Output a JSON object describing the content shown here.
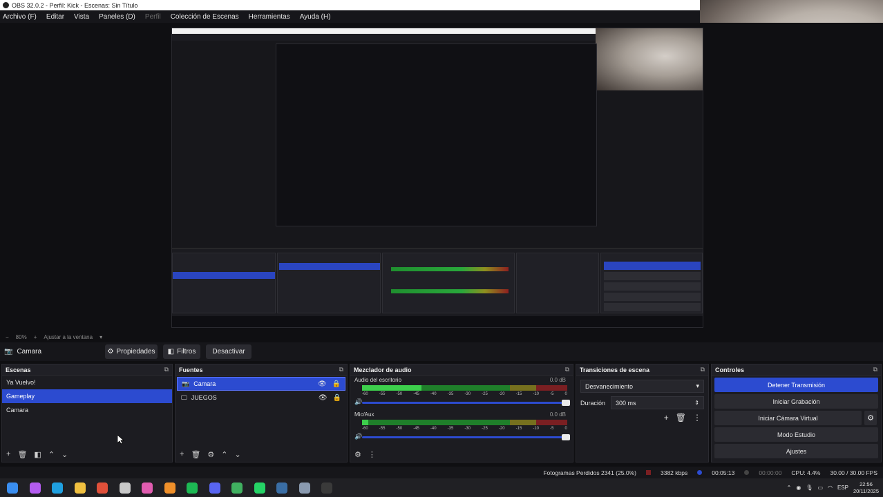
{
  "window": {
    "title": "OBS 32.0.2 - Perfil: Kick - Escenas: Sin Título"
  },
  "menu": [
    {
      "label": "Archivo (F)",
      "enabled": true
    },
    {
      "label": "Editar",
      "enabled": true
    },
    {
      "label": "Vista",
      "enabled": true
    },
    {
      "label": "Paneles (D)",
      "enabled": true
    },
    {
      "label": "Perfil",
      "enabled": false
    },
    {
      "label": "Colección de Escenas",
      "enabled": true
    },
    {
      "label": "Herramientas",
      "enabled": true
    },
    {
      "label": "Ayuda (H)",
      "enabled": true
    }
  ],
  "zoom": {
    "percent": "80%",
    "fit_label": "Ajustar a la ventana"
  },
  "source_toolbar": {
    "selected_source": "Camara",
    "properties_label": "Propiedades",
    "filters_label": "Filtros",
    "deactivate_label": "Desactivar"
  },
  "scenes": {
    "title": "Escenas",
    "items": [
      "Ya Vuelvo!",
      "Gameplay",
      "Camara"
    ],
    "selected_index": 1
  },
  "sources": {
    "title": "Fuentes",
    "items": [
      {
        "label": "Camara",
        "icon": "camera-icon",
        "selected": true
      },
      {
        "label": "JUEGOS",
        "icon": "monitor-icon",
        "selected": false
      }
    ]
  },
  "mixer": {
    "title": "Mezclador de audio",
    "channels": [
      {
        "name": "Audio del escritorio",
        "db": "0.0 dB",
        "level": 0.29
      },
      {
        "name": "Mic/Aux",
        "db": "0.0 dB",
        "level": 0.03
      }
    ],
    "ticks": [
      "-60",
      "-55",
      "-50",
      "-45",
      "-40",
      "-35",
      "-30",
      "-25",
      "-20",
      "-15",
      "-10",
      "-5",
      "0"
    ]
  },
  "transitions": {
    "title": "Transiciones de escena",
    "selected": "Desvanecimiento",
    "duration_label": "Duración",
    "duration_value": "300 ms"
  },
  "controls": {
    "title": "Controles",
    "buttons": [
      "Detener Transmisión",
      "Iniciar Grabación",
      "Iniciar Cámara Virtual",
      "Modo Estudio",
      "Ajustes"
    ]
  },
  "status": {
    "dropped_frames": "Fotogramas Perdidos 2341 (25.0%)",
    "bitrate": "3382 kbps",
    "stream_time": "00:05:13",
    "rec_time": "00:00:00",
    "cpu": "CPU: 4.4%",
    "fps": "30.00 / 30.00 FPS"
  },
  "taskbar": {
    "apps": [
      {
        "name": "windows-start-icon",
        "color": "#3a8ef0"
      },
      {
        "name": "copilot-icon",
        "color": "#b45cf0"
      },
      {
        "name": "edge-icon",
        "color": "#1fa0e0"
      },
      {
        "name": "file-explorer-icon",
        "color": "#f0c040"
      },
      {
        "name": "chrome-icon",
        "color": "#e0503a"
      },
      {
        "name": "app-icon",
        "color": "#c8c8c8"
      },
      {
        "name": "paint-icon",
        "color": "#e05cb0"
      },
      {
        "name": "sublime-icon",
        "color": "#f0902a"
      },
      {
        "name": "spotify-icon",
        "color": "#1db954"
      },
      {
        "name": "discord-icon",
        "color": "#5865f2"
      },
      {
        "name": "chrome-alt-icon",
        "color": "#40b060"
      },
      {
        "name": "whatsapp-icon",
        "color": "#25d366"
      },
      {
        "name": "steam-icon",
        "color": "#3a6ea5"
      },
      {
        "name": "monitor-app-icon",
        "color": "#8a9ab0"
      },
      {
        "name": "obs-icon",
        "color": "#3a3a3a"
      }
    ],
    "tray": {
      "lang": "ESP",
      "time": "22:56",
      "date": "20/11/2025"
    }
  }
}
